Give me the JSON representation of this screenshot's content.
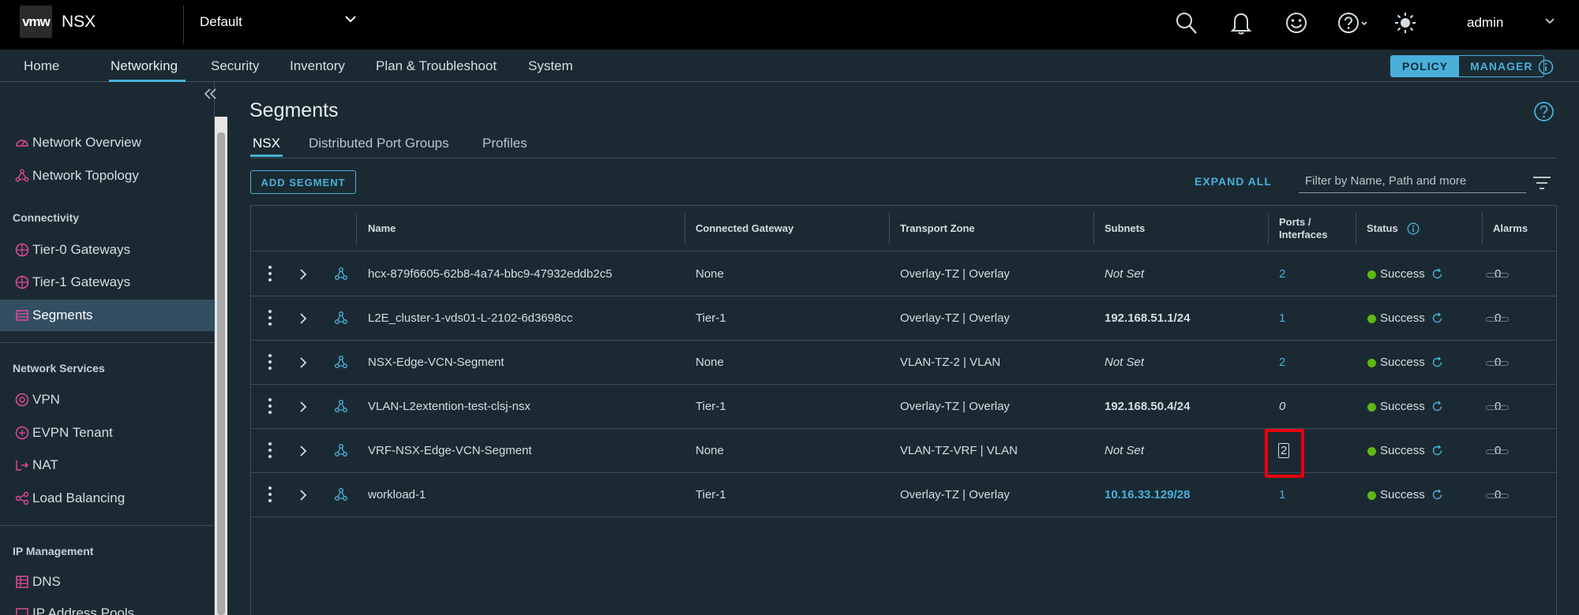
{
  "topbar": {
    "logo": "vmw",
    "app_name": "NSX",
    "context": "Default",
    "user": "admin"
  },
  "nav": {
    "items": [
      "Home",
      "Networking",
      "Security",
      "Inventory",
      "Plan & Troubleshoot",
      "System"
    ],
    "active": "Networking",
    "mode_policy": "POLICY",
    "mode_manager": "MANAGER"
  },
  "sidebar": {
    "top_items": [
      {
        "label": "Network Overview",
        "icon": "gauge-icon"
      },
      {
        "label": "Network Topology",
        "icon": "topology-icon"
      }
    ],
    "section_connectivity": "Connectivity",
    "connectivity_items": [
      {
        "label": "Tier-0 Gateways",
        "icon": "gateway-icon"
      },
      {
        "label": "Tier-1 Gateways",
        "icon": "gateway-icon"
      },
      {
        "label": "Segments",
        "icon": "segments-icon"
      }
    ],
    "section_services": "Network Services",
    "service_items": [
      {
        "label": "VPN",
        "icon": "vpn-icon"
      },
      {
        "label": "EVPN Tenant",
        "icon": "evpn-icon"
      },
      {
        "label": "NAT",
        "icon": "nat-icon"
      },
      {
        "label": "Load Balancing",
        "icon": "load-balancing-icon"
      }
    ],
    "section_ip": "IP Management",
    "ip_items": [
      {
        "label": "DNS",
        "icon": "dns-icon"
      },
      {
        "label": "IP Address Pools",
        "icon": "ip-pool-icon"
      }
    ]
  },
  "page": {
    "title": "Segments",
    "tabs": [
      "NSX",
      "Distributed Port Groups",
      "Profiles"
    ],
    "add_button": "ADD SEGMENT",
    "expand_all": "EXPAND ALL",
    "filter_placeholder": "Filter by Name, Path and more"
  },
  "table": {
    "headers": {
      "name": "Name",
      "gateway": "Connected Gateway",
      "zone": "Transport Zone",
      "subnets": "Subnets",
      "ports_line1": "Ports /",
      "ports_line2": "Interfaces",
      "status": "Status",
      "alarms": "Alarms"
    },
    "rows": [
      {
        "name": "hcx-879f6605-62b8-4a74-bbc9-47932eddb2c5",
        "gateway": "None",
        "zone": "Overlay-TZ | Overlay",
        "subnets": "Not Set",
        "ports": "2",
        "status": "Success",
        "alarms": "0"
      },
      {
        "name": "L2E_cluster-1-vds01-L-2102-6d3698cc",
        "gateway": "Tier-1",
        "zone": "Overlay-TZ | Overlay",
        "subnets": "192.168.51.1/24",
        "ports": "1",
        "status": "Success",
        "alarms": "0"
      },
      {
        "name": "NSX-Edge-VCN-Segment",
        "gateway": "None",
        "zone": "VLAN-TZ-2 | VLAN",
        "subnets": "Not Set",
        "ports": "2",
        "status": "Success",
        "alarms": "0"
      },
      {
        "name": "VLAN-L2extention-test-clsj-nsx",
        "gateway": "Tier-1",
        "zone": "Overlay-TZ | Overlay",
        "subnets": "192.168.50.4/24",
        "ports": "0",
        "status": "Success",
        "alarms": "0"
      },
      {
        "name": "VRF-NSX-Edge-VCN-Segment",
        "gateway": "None",
        "zone": "VLAN-TZ-VRF | VLAN",
        "subnets": "Not Set",
        "ports": "2",
        "status": "Success",
        "alarms": "0"
      },
      {
        "name": "workload-1",
        "gateway": "Tier-1",
        "zone": "Overlay-TZ | Overlay",
        "subnets": "10.16.33.129/28",
        "ports": "1",
        "status": "Success",
        "alarms": "0"
      }
    ]
  },
  "colors": {
    "accent": "#49afd9",
    "success": "#5eb715",
    "highlight": "#e8000d",
    "icon_pink": "#e3489a"
  }
}
